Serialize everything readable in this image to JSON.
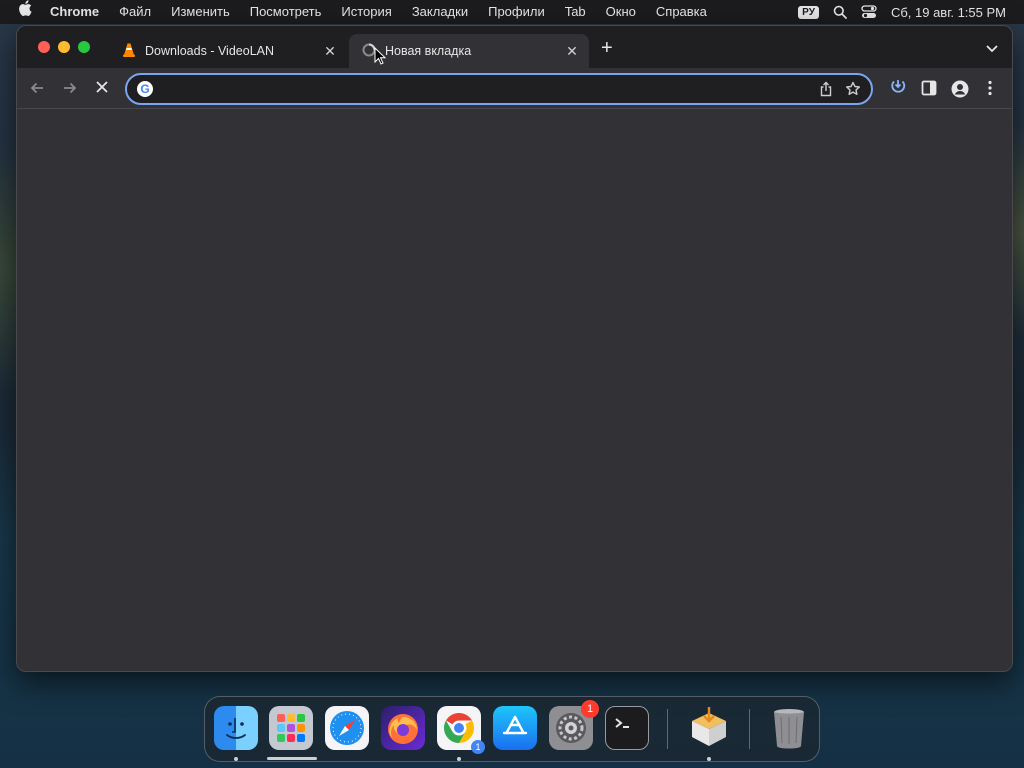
{
  "menubar": {
    "app_name": "Chrome",
    "items": [
      "Файл",
      "Изменить",
      "Посмотреть",
      "История",
      "Закладки",
      "Профили",
      "Tab",
      "Окно",
      "Справка"
    ],
    "input_source": "РУ",
    "datetime": "Сб, 19 авг.  1:55 PM"
  },
  "browser": {
    "tabs": [
      {
        "title": "Downloads - VideoLAN",
        "icon": "vlc-cone-icon",
        "active": false
      },
      {
        "title": "Новая вкладка",
        "icon": "loading-icon",
        "active": true
      }
    ],
    "omnibox": {
      "value": "",
      "placeholder": ""
    },
    "accent_color": "#7ca4f0"
  },
  "dock": {
    "apps": [
      {
        "name": "finder",
        "running": true
      },
      {
        "name": "launchpad",
        "running": true
      },
      {
        "name": "safari",
        "running": false
      },
      {
        "name": "firefox",
        "running": false
      },
      {
        "name": "chrome",
        "running": true,
        "badge": "1"
      },
      {
        "name": "app-store",
        "running": false
      },
      {
        "name": "system-settings",
        "running": false,
        "badge": "1"
      },
      {
        "name": "terminal",
        "running": false
      },
      {
        "name": "installer",
        "running": true
      },
      {
        "name": "trash",
        "running": false
      }
    ]
  }
}
